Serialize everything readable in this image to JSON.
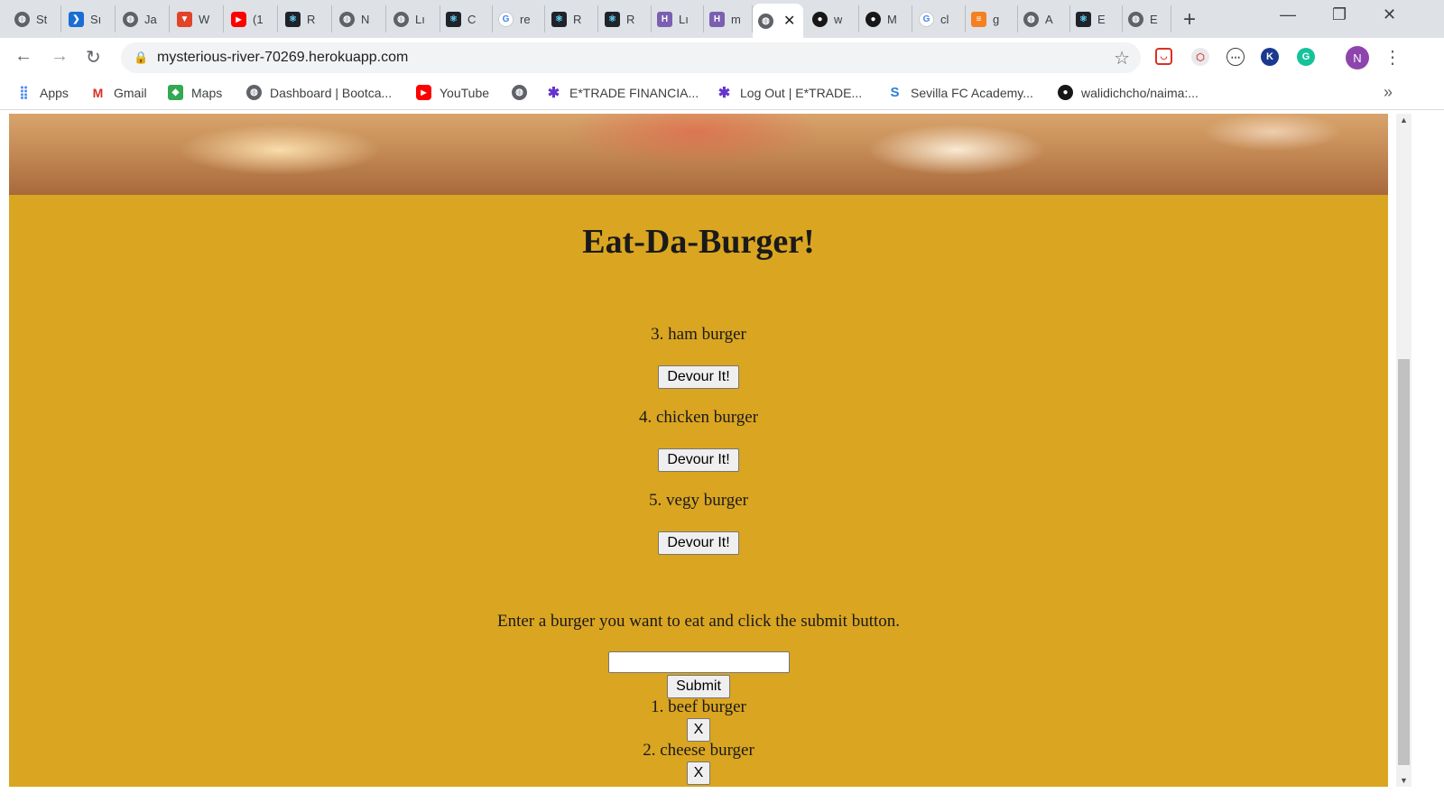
{
  "browser": {
    "tabs": [
      {
        "label": "St",
        "icon": "globe-icon"
      },
      {
        "label": "Sı",
        "icon": "bird-icon"
      },
      {
        "label": "Ja",
        "icon": "globe-icon"
      },
      {
        "label": "W",
        "icon": "gitlab-icon"
      },
      {
        "label": "(1",
        "icon": "youtube-icon"
      },
      {
        "label": "R",
        "icon": "react-icon"
      },
      {
        "label": "N",
        "icon": "globe-icon"
      },
      {
        "label": "Lı",
        "icon": "globe-icon"
      },
      {
        "label": "C",
        "icon": "react-icon"
      },
      {
        "label": "re",
        "icon": "google-icon"
      },
      {
        "label": "R",
        "icon": "react-icon"
      },
      {
        "label": "R",
        "icon": "react-icon"
      },
      {
        "label": "Lı",
        "icon": "heroku-icon"
      },
      {
        "label": "m",
        "icon": "heroku-icon"
      },
      {
        "label": "",
        "icon": "globe-icon",
        "active": true
      },
      {
        "label": "w",
        "icon": "github-icon"
      },
      {
        "label": "M",
        "icon": "github-icon"
      },
      {
        "label": "cl",
        "icon": "google-icon"
      },
      {
        "label": "g",
        "icon": "stackoverflow-icon"
      },
      {
        "label": "A",
        "icon": "globe-icon"
      },
      {
        "label": "E",
        "icon": "react-icon"
      },
      {
        "label": "E",
        "icon": "globe-icon"
      }
    ],
    "url": "mysterious-river-70269.herokuapp.com",
    "profile_initial": "N",
    "bookmarks": [
      {
        "label": "Apps",
        "icon": "apps-grid-icon"
      },
      {
        "label": "Gmail",
        "icon": "gmail-icon"
      },
      {
        "label": "Maps",
        "icon": "maps-icon"
      },
      {
        "label": "Dashboard | Bootca...",
        "icon": "globe-icon"
      },
      {
        "label": "YouTube",
        "icon": "youtube-icon"
      },
      {
        "label": "",
        "icon": "globe-icon"
      },
      {
        "label": "E*TRADE FINANCIA...",
        "icon": "etrade-icon"
      },
      {
        "label": "Log Out | E*TRADE...",
        "icon": "etrade-icon"
      },
      {
        "label": "Sevilla FC Academy...",
        "icon": "sevilla-icon"
      },
      {
        "label": "walidichcho/naima:...",
        "icon": "github-icon"
      }
    ]
  },
  "page": {
    "title": "Eat-Da-Burger!",
    "colors": {
      "background": "#daa520",
      "text": "#1a1a1a"
    },
    "uneaten": [
      {
        "name": "3. ham burger",
        "button": "Devour It!"
      },
      {
        "name": "4. chicken burger",
        "button": "Devour It!"
      },
      {
        "name": "5. vegy burger",
        "button": "Devour It!"
      }
    ],
    "form": {
      "prompt": "Enter a burger you want to eat and click the submit button.",
      "input_value": "",
      "submit_label": "Submit"
    },
    "devoured": [
      {
        "name": "1. beef burger",
        "button": "X"
      },
      {
        "name": "2. cheese burger",
        "button": "X"
      }
    ]
  }
}
